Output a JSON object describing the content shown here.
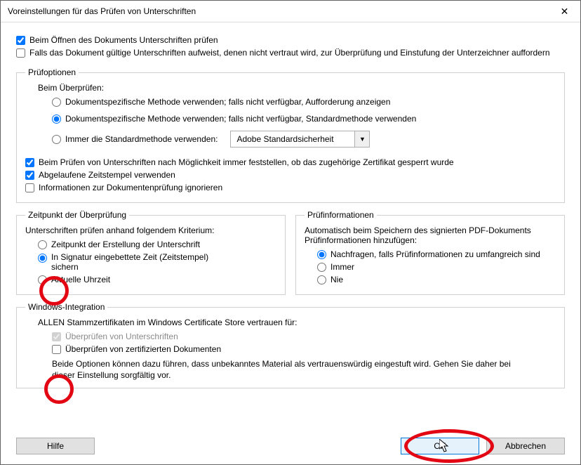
{
  "window": {
    "title": "Voreinstellungen für das Prüfen von Unterschriften"
  },
  "top": {
    "verify_on_open": "Beim Öffnen des Dokuments Unterschriften prüfen",
    "prompt_untrusted": "Falls das Dokument gültige Unterschriften aufweist, denen nicht vertraut wird, zur Überprüfung und Einstufung der Unterzeichner auffordern"
  },
  "pruefoptionen": {
    "legend": "Prüfoptionen",
    "beim_ueberpruefen": "Beim Überprüfen:",
    "method_doc_prompt": "Dokumentspezifische Methode verwenden; falls nicht verfügbar, Aufforderung anzeigen",
    "method_doc_default": "Dokumentspezifische Methode verwenden; falls nicht verfügbar, Standardmethode verwenden",
    "method_always_default": "Immer die Standardmethode verwenden:",
    "default_method_value": "Adobe Standardsicherheit",
    "check_revocation": "Beim Prüfen von Unterschriften nach Möglichkeit immer feststellen, ob das zugehörige Zertifikat gesperrt wurde",
    "use_expired_timestamps": "Abgelaufene Zeitstempel verwenden",
    "ignore_docinfo": "Informationen zur Dokumentenprüfung ignorieren"
  },
  "zeitpunkt": {
    "legend": "Zeitpunkt der Überprüfung",
    "intro": "Unterschriften prüfen anhand folgendem Kriterium:",
    "opt_creation": "Zeitpunkt der Erstellung der Unterschrift",
    "opt_embedded": "In Signatur eingebettete Zeit (Zeitstempel) sichern",
    "opt_now": "Aktuelle Uhrzeit"
  },
  "pruefinfo": {
    "legend": "Prüfinformationen",
    "intro": "Automatisch beim Speichern des signierten PDF-Dokuments Prüfinformationen hinzufügen:",
    "opt_ask": "Nachfragen, falls Prüfinformationen zu umfangreich sind",
    "opt_always": "Immer",
    "opt_never": "Nie"
  },
  "winint": {
    "legend": "Windows-Integration",
    "intro": "ALLEN Stammzertifikaten im Windows Certificate Store vertrauen für:",
    "chk_sigs": "Überprüfen von Unterschriften",
    "chk_certdocs": "Überprüfen von zertifizierten Dokumenten",
    "note": "Beide Optionen können dazu führen, dass unbekanntes Material als vertrauenswürdig eingestuft wird. Gehen Sie daher bei dieser Einstellung sorgfältig vor."
  },
  "buttons": {
    "help": "Hilfe",
    "ok": "OK",
    "cancel": "Abbrechen"
  }
}
